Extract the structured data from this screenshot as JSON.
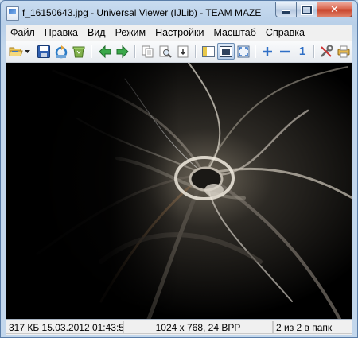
{
  "window": {
    "title": "f_16150643.jpg - Universal Viewer (IJLib) - TEAM MAZE",
    "close_glyph": "✕"
  },
  "menu": {
    "items": [
      "Файл",
      "Правка",
      "Вид",
      "Режим",
      "Настройки",
      "Масштаб",
      "Справка"
    ]
  },
  "toolbar": {
    "buttons": [
      "open-folder-icon",
      "dropdown-arrow-icon",
      "save-icon",
      "rotate-icon",
      "recycle-bin-icon",
      "arrow-left-icon",
      "arrow-right-icon",
      "copy-icon",
      "search-icon",
      "paste-icon",
      "sidebar-icon",
      "fit-window-icon",
      "fullscreen-icon",
      "zoom-in-icon",
      "zoom-out-icon",
      "actual-size-icon",
      "tools-icon",
      "print-icon"
    ],
    "actual_size_label": "1",
    "active_button": "fit-window-icon"
  },
  "status": {
    "file_info": "317 КБ 15.03.2012 01:43:5",
    "image_info": "1024 x 768, 24 BPP",
    "position": "2 из 2 в папк"
  },
  "colors": {
    "window_frame": "#b8cfe8",
    "close_button": "#c7422a",
    "arrow_green": "#3aa84a",
    "zoom_blue": "#2f6fc6"
  }
}
